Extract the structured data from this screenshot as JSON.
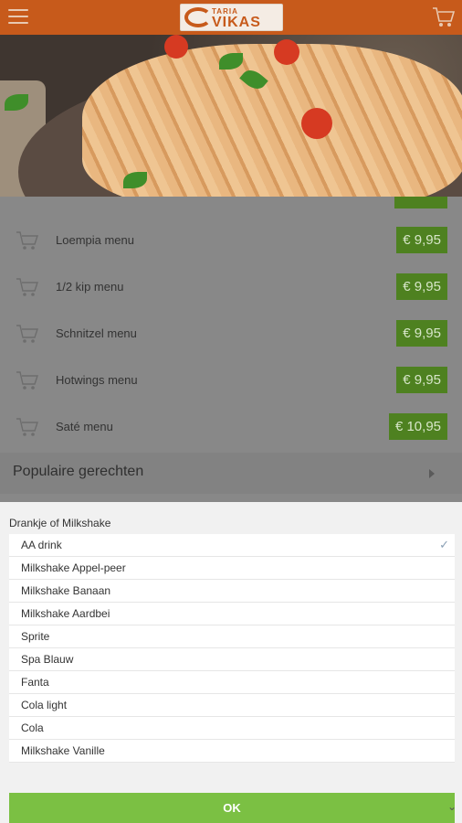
{
  "header": {
    "logo_top": "TARIA",
    "logo_main": "VIKAS",
    "menu_icon": "hamburger-icon",
    "cart_icon": "cart-icon",
    "bg_color": "#c75a1b"
  },
  "menu": {
    "items": [
      {
        "name": "Loempia menu",
        "price": "€ 9,95"
      },
      {
        "name": "1/2 kip menu",
        "price": "€ 9,95"
      },
      {
        "name": "Schnitzel menu",
        "price": "€ 9,95"
      },
      {
        "name": "Hotwings menu",
        "price": "€ 9,95"
      },
      {
        "name": "Saté menu",
        "price": "€ 10,95"
      }
    ],
    "section_title": "Populaire gerechten",
    "price_color": "#4e8120"
  },
  "sheet": {
    "title": "Drankje of Milkshake",
    "options": [
      {
        "label": "AA drink",
        "selected": true
      },
      {
        "label": "Milkshake Appel-peer",
        "selected": false
      },
      {
        "label": "Milkshake Banaan",
        "selected": false
      },
      {
        "label": "Milkshake Aardbei",
        "selected": false
      },
      {
        "label": "Sprite",
        "selected": false
      },
      {
        "label": "Spa Blauw",
        "selected": false
      },
      {
        "label": "Fanta",
        "selected": false
      },
      {
        "label": "Cola light",
        "selected": false
      },
      {
        "label": "Cola",
        "selected": false
      },
      {
        "label": "Milkshake Vanille",
        "selected": false
      }
    ],
    "ok_label": "OK",
    "ok_color": "#7bc043"
  }
}
